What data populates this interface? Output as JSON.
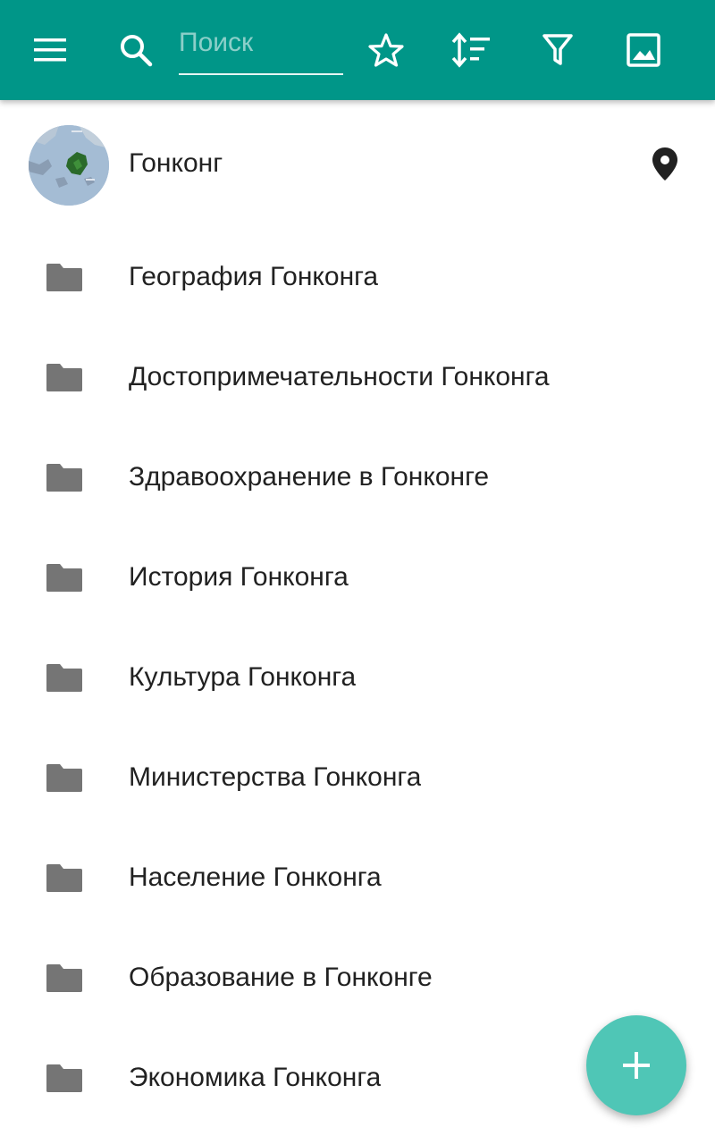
{
  "toolbar": {
    "search_placeholder": "Поиск",
    "icons": [
      "menu-icon",
      "search-icon",
      "star-icon",
      "sort-icon",
      "filter-icon",
      "image-icon"
    ]
  },
  "header_item": {
    "title": "Гонконг",
    "icon": "location-pin-icon"
  },
  "categories": [
    {
      "label": "География Гонконга",
      "icon": "folder-icon"
    },
    {
      "label": "Достопримечательности Гонконга",
      "icon": "folder-icon"
    },
    {
      "label": "Здравоохранение в Гонконге",
      "icon": "folder-icon"
    },
    {
      "label": "История Гонконга",
      "icon": "folder-icon"
    },
    {
      "label": "Культура Гонконга",
      "icon": "folder-icon"
    },
    {
      "label": "Министерства Гонконга",
      "icon": "folder-icon"
    },
    {
      "label": "Население Гонконга",
      "icon": "folder-icon"
    },
    {
      "label": "Образование в Гонконге",
      "icon": "folder-icon"
    },
    {
      "label": "Экономика Гонконга",
      "icon": "folder-icon"
    }
  ],
  "fab": {
    "icon": "add-icon"
  },
  "colors": {
    "appbar": "#009688",
    "fab": "#4fc6b6",
    "folder": "#757575"
  }
}
